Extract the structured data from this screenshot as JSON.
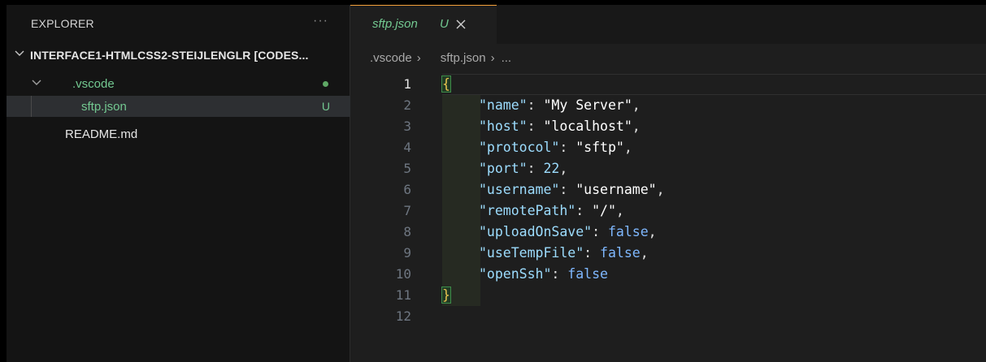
{
  "sidebar": {
    "title": "EXPLORER",
    "more_label": "···",
    "workspace": "INTERFACE1-HTMLCSS2-STEIJLENGLR [CODES...",
    "folder": ".vscode",
    "files": [
      {
        "name": "sftp.json",
        "badge": "U"
      },
      {
        "name": "README.md"
      }
    ]
  },
  "tab": {
    "label": "sftp.json",
    "badge": "U"
  },
  "breadcrumb": {
    "folder": ".vscode",
    "file": "sftp.json",
    "more": "..."
  },
  "editor": {
    "line_numbers": [
      "1",
      "2",
      "3",
      "4",
      "5",
      "6",
      "7",
      "8",
      "9",
      "10",
      "11",
      "12"
    ],
    "open_brace": "{",
    "close_brace": "}",
    "entries": [
      {
        "key": "\"name\"",
        "value": "\"My Server\"",
        "comma": ","
      },
      {
        "key": "\"host\"",
        "value": "\"localhost\"",
        "comma": ","
      },
      {
        "key": "\"protocol\"",
        "value": "\"sftp\"",
        "comma": ","
      },
      {
        "key": "\"port\"",
        "value": "22",
        "comma": ","
      },
      {
        "key": "\"username\"",
        "value": "\"username\"",
        "comma": ","
      },
      {
        "key": "\"remotePath\"",
        "value": "\"/\"",
        "comma": ","
      },
      {
        "key": "\"uploadOnSave\"",
        "value": "false",
        "comma": ","
      },
      {
        "key": "\"useTempFile\"",
        "value": "false",
        "comma": ","
      },
      {
        "key": "\"openSsh\"",
        "value": "false",
        "comma": ""
      }
    ]
  },
  "colors": {
    "accent_tab_border": "#f4a13a",
    "untracked_green": "#73c991",
    "brace_yellow": "#e8c44f",
    "key_blue": "#9cdcfe"
  }
}
